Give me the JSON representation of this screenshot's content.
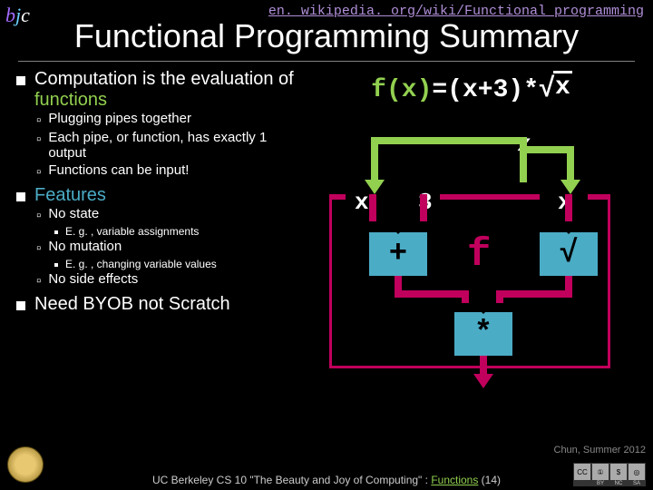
{
  "url": "en. wikipedia. org/wiki/Functional_programming",
  "title": "Functional Programming Summary",
  "bullets": {
    "b1": {
      "pre": "Computation is the evaluation of ",
      "accent": "functions",
      "sub": [
        "Plugging pipes together",
        "Each pipe, or function, has exactly 1 output",
        "Functions can be input!"
      ]
    },
    "b2": {
      "text": "Features",
      "sub": [
        {
          "t": "No state",
          "eg": "E. g. , variable assignments"
        },
        {
          "t": "No mutation",
          "eg": "E. g. , changing variable values"
        },
        {
          "t": "No side effects"
        }
      ]
    },
    "b3": {
      "text": "Need BYOB not Scratch"
    }
  },
  "formula": {
    "lhs": "f(x)",
    "mid": "=(x+3)*",
    "sqrt_arg": "x"
  },
  "diagram": {
    "top": "x",
    "left_in1": "x",
    "left_in2": "3",
    "right_in": "x",
    "plus": "+",
    "sqrt": "√",
    "mul": "*",
    "f": "f"
  },
  "attribution": "Chun, Summer 2012",
  "footer": {
    "pre": "UC Berkeley CS 10 \"The Beauty and Joy of Computing\" : ",
    "link": "Functions",
    "post": " (14)"
  },
  "cc": [
    "CC",
    "BY",
    "NC",
    "SA"
  ]
}
